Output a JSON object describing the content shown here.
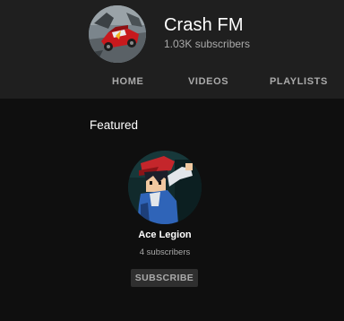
{
  "channel": {
    "name": "Crash FM",
    "subscribers": "1.03K subscribers",
    "avatar_icon": "wrecked-red-car-avatar"
  },
  "tabs": [
    {
      "label": "HOME"
    },
    {
      "label": "VIDEOS"
    },
    {
      "label": "PLAYLISTS"
    }
  ],
  "featured": {
    "title": "Featured",
    "channel": {
      "name": "Ace Legion",
      "subscribers": "4 subscribers",
      "avatar_icon": "pixel-art-character-avatar"
    },
    "subscribe_label": "SUBSCRIBE"
  },
  "colors": {
    "background": "#0f0f0f",
    "header_background": "#1f1f1f",
    "secondary_text": "#aaaaaa",
    "button_background": "#2f2f2f"
  }
}
